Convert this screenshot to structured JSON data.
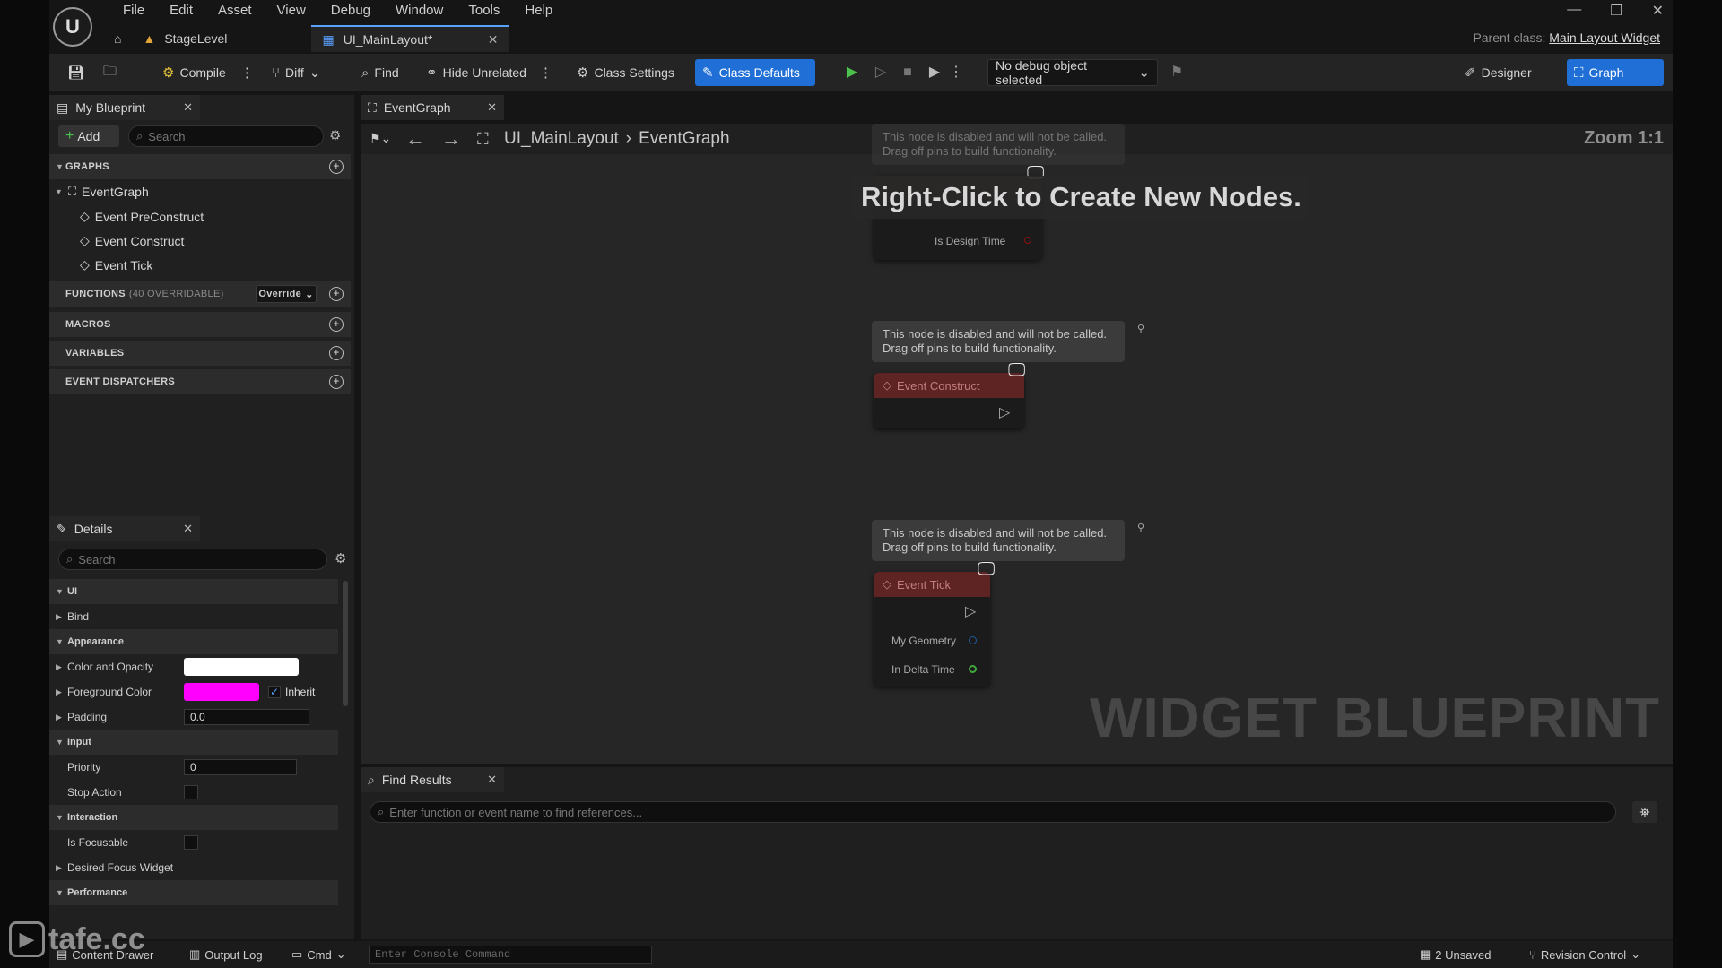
{
  "menubar": {
    "items": [
      "File",
      "Edit",
      "Asset",
      "View",
      "Debug",
      "Window",
      "Tools",
      "Help"
    ],
    "tabs": [
      {
        "label": "StageLevel"
      },
      {
        "label": "UI_MainLayout*"
      }
    ],
    "parent_class_label": "Parent class:",
    "parent_class_value": "Main Layout Widget"
  },
  "toolbar": {
    "compile": "Compile",
    "diff": "Diff",
    "find": "Find",
    "hide_unrelated": "Hide Unrelated",
    "class_settings": "Class Settings",
    "class_defaults": "Class Defaults",
    "debug_object": "No debug object selected",
    "designer": "Designer",
    "graph": "Graph"
  },
  "my_blueprint": {
    "tab": "My Blueprint",
    "add": "Add",
    "search_placeholder": "Search",
    "sections": {
      "graphs": "GRAPHS",
      "functions": "FUNCTIONS",
      "functions_count": "(40 OVERRIDABLE)",
      "override": "Override",
      "macros": "MACROS",
      "variables": "VARIABLES",
      "event_dispatchers": "EVENT DISPATCHERS"
    },
    "graph_tree": {
      "root": "EventGraph",
      "children": [
        "Event PreConstruct",
        "Event Construct",
        "Event Tick"
      ]
    }
  },
  "details": {
    "tab": "Details",
    "search_placeholder": "Search",
    "rows": {
      "ui": "UI",
      "bind": "Bind",
      "appearance": "Appearance",
      "color_opacity": "Color and Opacity",
      "foreground_color": "Foreground Color",
      "inherit": "Inherit",
      "padding": "Padding",
      "padding_value": "0.0",
      "input": "Input",
      "priority": "Priority",
      "priority_value": "0",
      "stop_action": "Stop Action",
      "interaction": "Interaction",
      "is_focusable": "Is Focusable",
      "desired_focus": "Desired Focus Widget",
      "performance": "Performance"
    },
    "colors": {
      "color_opacity": "#ffffff",
      "foreground": "#ff00ff"
    }
  },
  "graph": {
    "tab": "EventGraph",
    "breadcrumb_root": "UI_MainLayout",
    "breadcrumb_current": "EventGraph",
    "zoom": "Zoom 1:1",
    "hint": "Right-Click to Create New Nodes.",
    "watermark": "WIDGET BLUEPRINT",
    "note_line1": "This node is disabled and will not be called.",
    "note_line2": "Drag off pins to build functionality.",
    "nodes": {
      "preconstruct_pin": "Is Design Time",
      "construct_title": "Event Construct",
      "tick_title": "Event Tick",
      "tick_pin1": "My Geometry",
      "tick_pin2": "In Delta Time"
    }
  },
  "find_results": {
    "tab": "Find Results",
    "placeholder": "Enter function or event name to find references..."
  },
  "statusbar": {
    "content_drawer": "Content Drawer",
    "output_log": "Output Log",
    "cmd": "Cmd",
    "console_placeholder": "Enter Console Command",
    "unsaved": "2 Unsaved",
    "revision": "Revision Control"
  },
  "overlay": {
    "watermark_text": "tafe.cc"
  }
}
